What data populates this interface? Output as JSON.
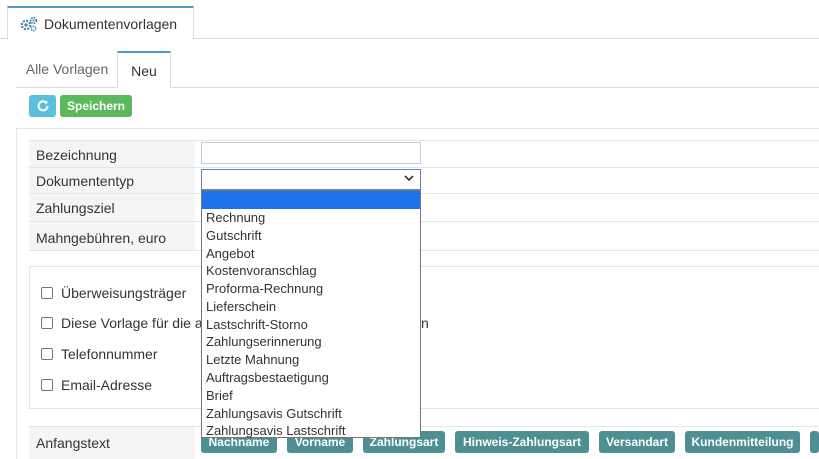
{
  "top_tab": {
    "label": "Dokumentenvorlagen",
    "icon": "gears-icon"
  },
  "sub_tabs": [
    {
      "label": "Alle Vorlagen",
      "active": false
    },
    {
      "label": "Neu",
      "active": true
    }
  ],
  "toolbar": {
    "refresh_icon": "refresh-icon",
    "refresh_symbol": "C",
    "save_label": "Speichern"
  },
  "form": {
    "fields": [
      {
        "label": "Bezeichnung",
        "value": ""
      },
      {
        "label": "Dokumententyp",
        "value": ""
      },
      {
        "label": "Zahlungsziel"
      },
      {
        "label": "Mahngebühren, euro"
      }
    ]
  },
  "dropdown": {
    "options": [
      "",
      "Rechnung",
      "Gutschrift",
      "Angebot",
      "Kostenvoranschlag",
      "Proforma-Rechnung",
      "Lieferschein",
      "Lastschrift-Storno",
      "Zahlungserinnerung",
      "Letzte Mahnung",
      "Auftragsbestaetigung",
      "Brief",
      "Zahlungsavis Gutschrift",
      "Zahlungsavis Lastschrift"
    ],
    "highlight_color": "#1e73e8"
  },
  "checkboxes": [
    {
      "label": "Überweisungsträger",
      "checked": false
    },
    {
      "label": "Diese Vorlage für die a",
      "checked": false
    },
    {
      "label": "Telefonnummer",
      "checked": false
    },
    {
      "label": "Email-Adresse",
      "checked": false
    }
  ],
  "checkbox_tail": "n",
  "anfangstext": {
    "label": "Anfangstext",
    "tags": [
      "Nachname",
      "Vorname",
      "Zahlungsart",
      "Hinweis-Zahlungsart",
      "Versandart",
      "Kundenmitteilung"
    ]
  },
  "colors": {
    "accent": "#4a9cc7",
    "save": "#5cb85c",
    "refresh": "#5bc0de",
    "tag": "#4d8f92"
  }
}
